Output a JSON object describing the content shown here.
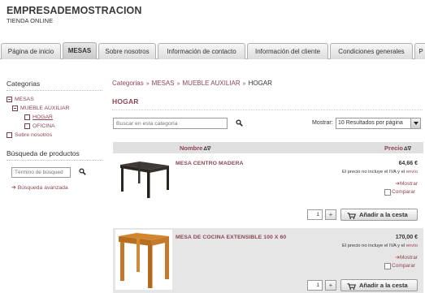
{
  "header": {
    "brand": "EMPRESADEMOSTRACION",
    "tagline": "TIENDA ONLINE"
  },
  "tabs": [
    {
      "label": "Página de inicio",
      "active": false
    },
    {
      "label": "MESAS",
      "active": true
    },
    {
      "label": "Sobre nosotros",
      "active": false
    },
    {
      "label": "Información de contacto",
      "active": false
    },
    {
      "label": "Información del cliente",
      "active": false
    },
    {
      "label": "Condiciones generales",
      "active": false
    },
    {
      "label": "P",
      "active": false
    }
  ],
  "sidebar": {
    "categories_title": "Categorias",
    "tree": [
      {
        "label": "MESAS",
        "level": 0,
        "box": "minus"
      },
      {
        "label": "MUEBLE AUXILIAR",
        "level": 1,
        "box": "minus"
      },
      {
        "label": "HOGAR",
        "level": 2,
        "box": "empty",
        "current": true
      },
      {
        "label": "OFICINA",
        "level": 2,
        "box": "empty"
      },
      {
        "label": "Sobre nosotros",
        "level": 0,
        "box": "empty"
      }
    ],
    "search_title": "Búsqueda de productos",
    "search_placeholder": "Término de búsqued",
    "advanced_search": "Búsqueda avanzada"
  },
  "breadcrumb": {
    "items": [
      "Categorias",
      "MESAS",
      "MUEBLE AUXILIAR"
    ],
    "separator": "»",
    "current": "HOGAR"
  },
  "page_title": "HOGAR",
  "filter": {
    "search_placeholder": "Buscar en esta categoría",
    "show_label": "Mostrar:",
    "show_value": "10 Resultados por página"
  },
  "list_header": {
    "name_label": "Nombre",
    "price_label": "Precio",
    "sort_glyph": "Δ∇"
  },
  "products": [
    {
      "name": "MESA CENTRO MADERA",
      "price": "64,66 €",
      "tax_note_prefix": "El precio no incluye el IVA y el",
      "tax_note_link": "envío",
      "more": "Mostrar",
      "compare": "Comparar",
      "qty": "1",
      "plus": "+",
      "add_to_cart": "Añadir a la cesta"
    },
    {
      "name": "MESA DE COCINA EXTENSIBLE 100 X 60",
      "price": "170,00 €",
      "tax_note_prefix": "El precio no incluye el IVA y el",
      "tax_note_link": "envío",
      "more": "Mostrar",
      "compare": "Comparar",
      "qty": "1",
      "plus": "+",
      "add_to_cart": "Añadir a la cesta"
    }
  ],
  "colors": {
    "link": "#8c4553",
    "tab_bg": "#dcdcdc",
    "list_header_bg": "#e0e0e0",
    "alt_row_bg": "#e6e6e6"
  },
  "icons": {
    "search": "magnifier-icon",
    "cart": "shopping-cart-icon",
    "arrow": "right-arrow-icon"
  }
}
